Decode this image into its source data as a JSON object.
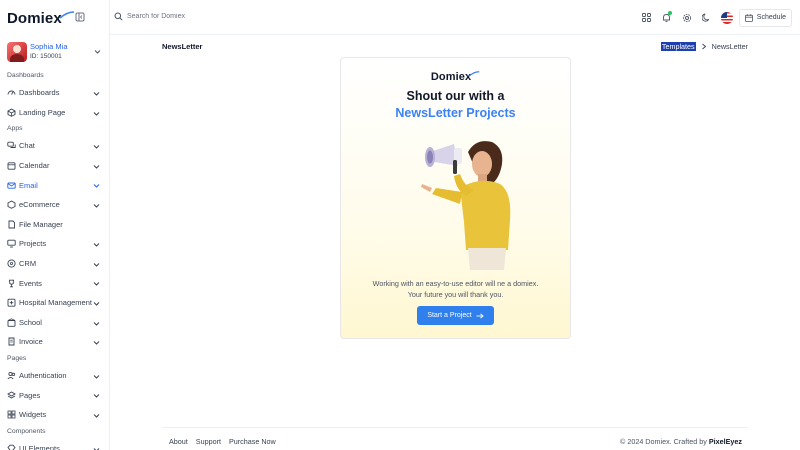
{
  "brand": {
    "name": "Domiex"
  },
  "user": {
    "name": "Sophia Mia",
    "id": "ID: 150001"
  },
  "sidebar": {
    "sections": [
      {
        "title": "Dashboards",
        "items": [
          {
            "label": "Dashboards",
            "icon": "gauge-icon",
            "has_chevron": true
          },
          {
            "label": "Landing Page",
            "icon": "box-icon",
            "has_chevron": true
          }
        ]
      },
      {
        "title": "Apps",
        "items": [
          {
            "label": "Chat",
            "icon": "chat-icon",
            "has_chevron": true
          },
          {
            "label": "Calendar",
            "icon": "calendar-icon",
            "has_chevron": true
          },
          {
            "label": "Email",
            "icon": "mail-icon",
            "has_chevron": true,
            "active": true
          },
          {
            "label": "eCommerce",
            "icon": "cube-icon",
            "has_chevron": true
          },
          {
            "label": "File Manager",
            "icon": "file-icon",
            "has_chevron": false
          },
          {
            "label": "Projects",
            "icon": "monitor-icon",
            "has_chevron": true
          },
          {
            "label": "CRM",
            "icon": "steering-icon",
            "has_chevron": true
          },
          {
            "label": "Events",
            "icon": "trophy-icon",
            "has_chevron": true
          },
          {
            "label": "Hospital Management",
            "icon": "hospital-icon",
            "has_chevron": true
          },
          {
            "label": "School",
            "icon": "school-icon",
            "has_chevron": true
          },
          {
            "label": "Invoice",
            "icon": "invoice-icon",
            "has_chevron": true
          }
        ]
      },
      {
        "title": "Pages",
        "items": [
          {
            "label": "Authentication",
            "icon": "users-icon",
            "has_chevron": true
          },
          {
            "label": "Pages",
            "icon": "layers-icon",
            "has_chevron": true
          },
          {
            "label": "Widgets",
            "icon": "widgets-icon",
            "has_chevron": true
          }
        ]
      },
      {
        "title": "Components",
        "items": [
          {
            "label": "UI Elements",
            "icon": "gem-icon",
            "has_chevron": true
          }
        ]
      }
    ]
  },
  "topbar": {
    "search_placeholder": "Search for Domiex",
    "schedule_label": "Schedule",
    "accent": "#22c55e"
  },
  "page": {
    "title": "NewsLetter",
    "breadcrumb": {
      "parent": "Templates",
      "current": "NewsLetter"
    }
  },
  "card": {
    "title": "Shout our with a",
    "subtitle": "NewsLetter Projects",
    "description_line1": "Working with an easy-to-use editor will ne a domiex.",
    "description_line2": "Your future you will thank you.",
    "cta_label": "Start a Project",
    "accent": "#3b82f6"
  },
  "footer": {
    "links": [
      "About",
      "Support",
      "Purchase Now"
    ],
    "copyright_prefix": "© 2024 Domiex. Crafted by",
    "copyright_brand": "PixelEyez"
  }
}
